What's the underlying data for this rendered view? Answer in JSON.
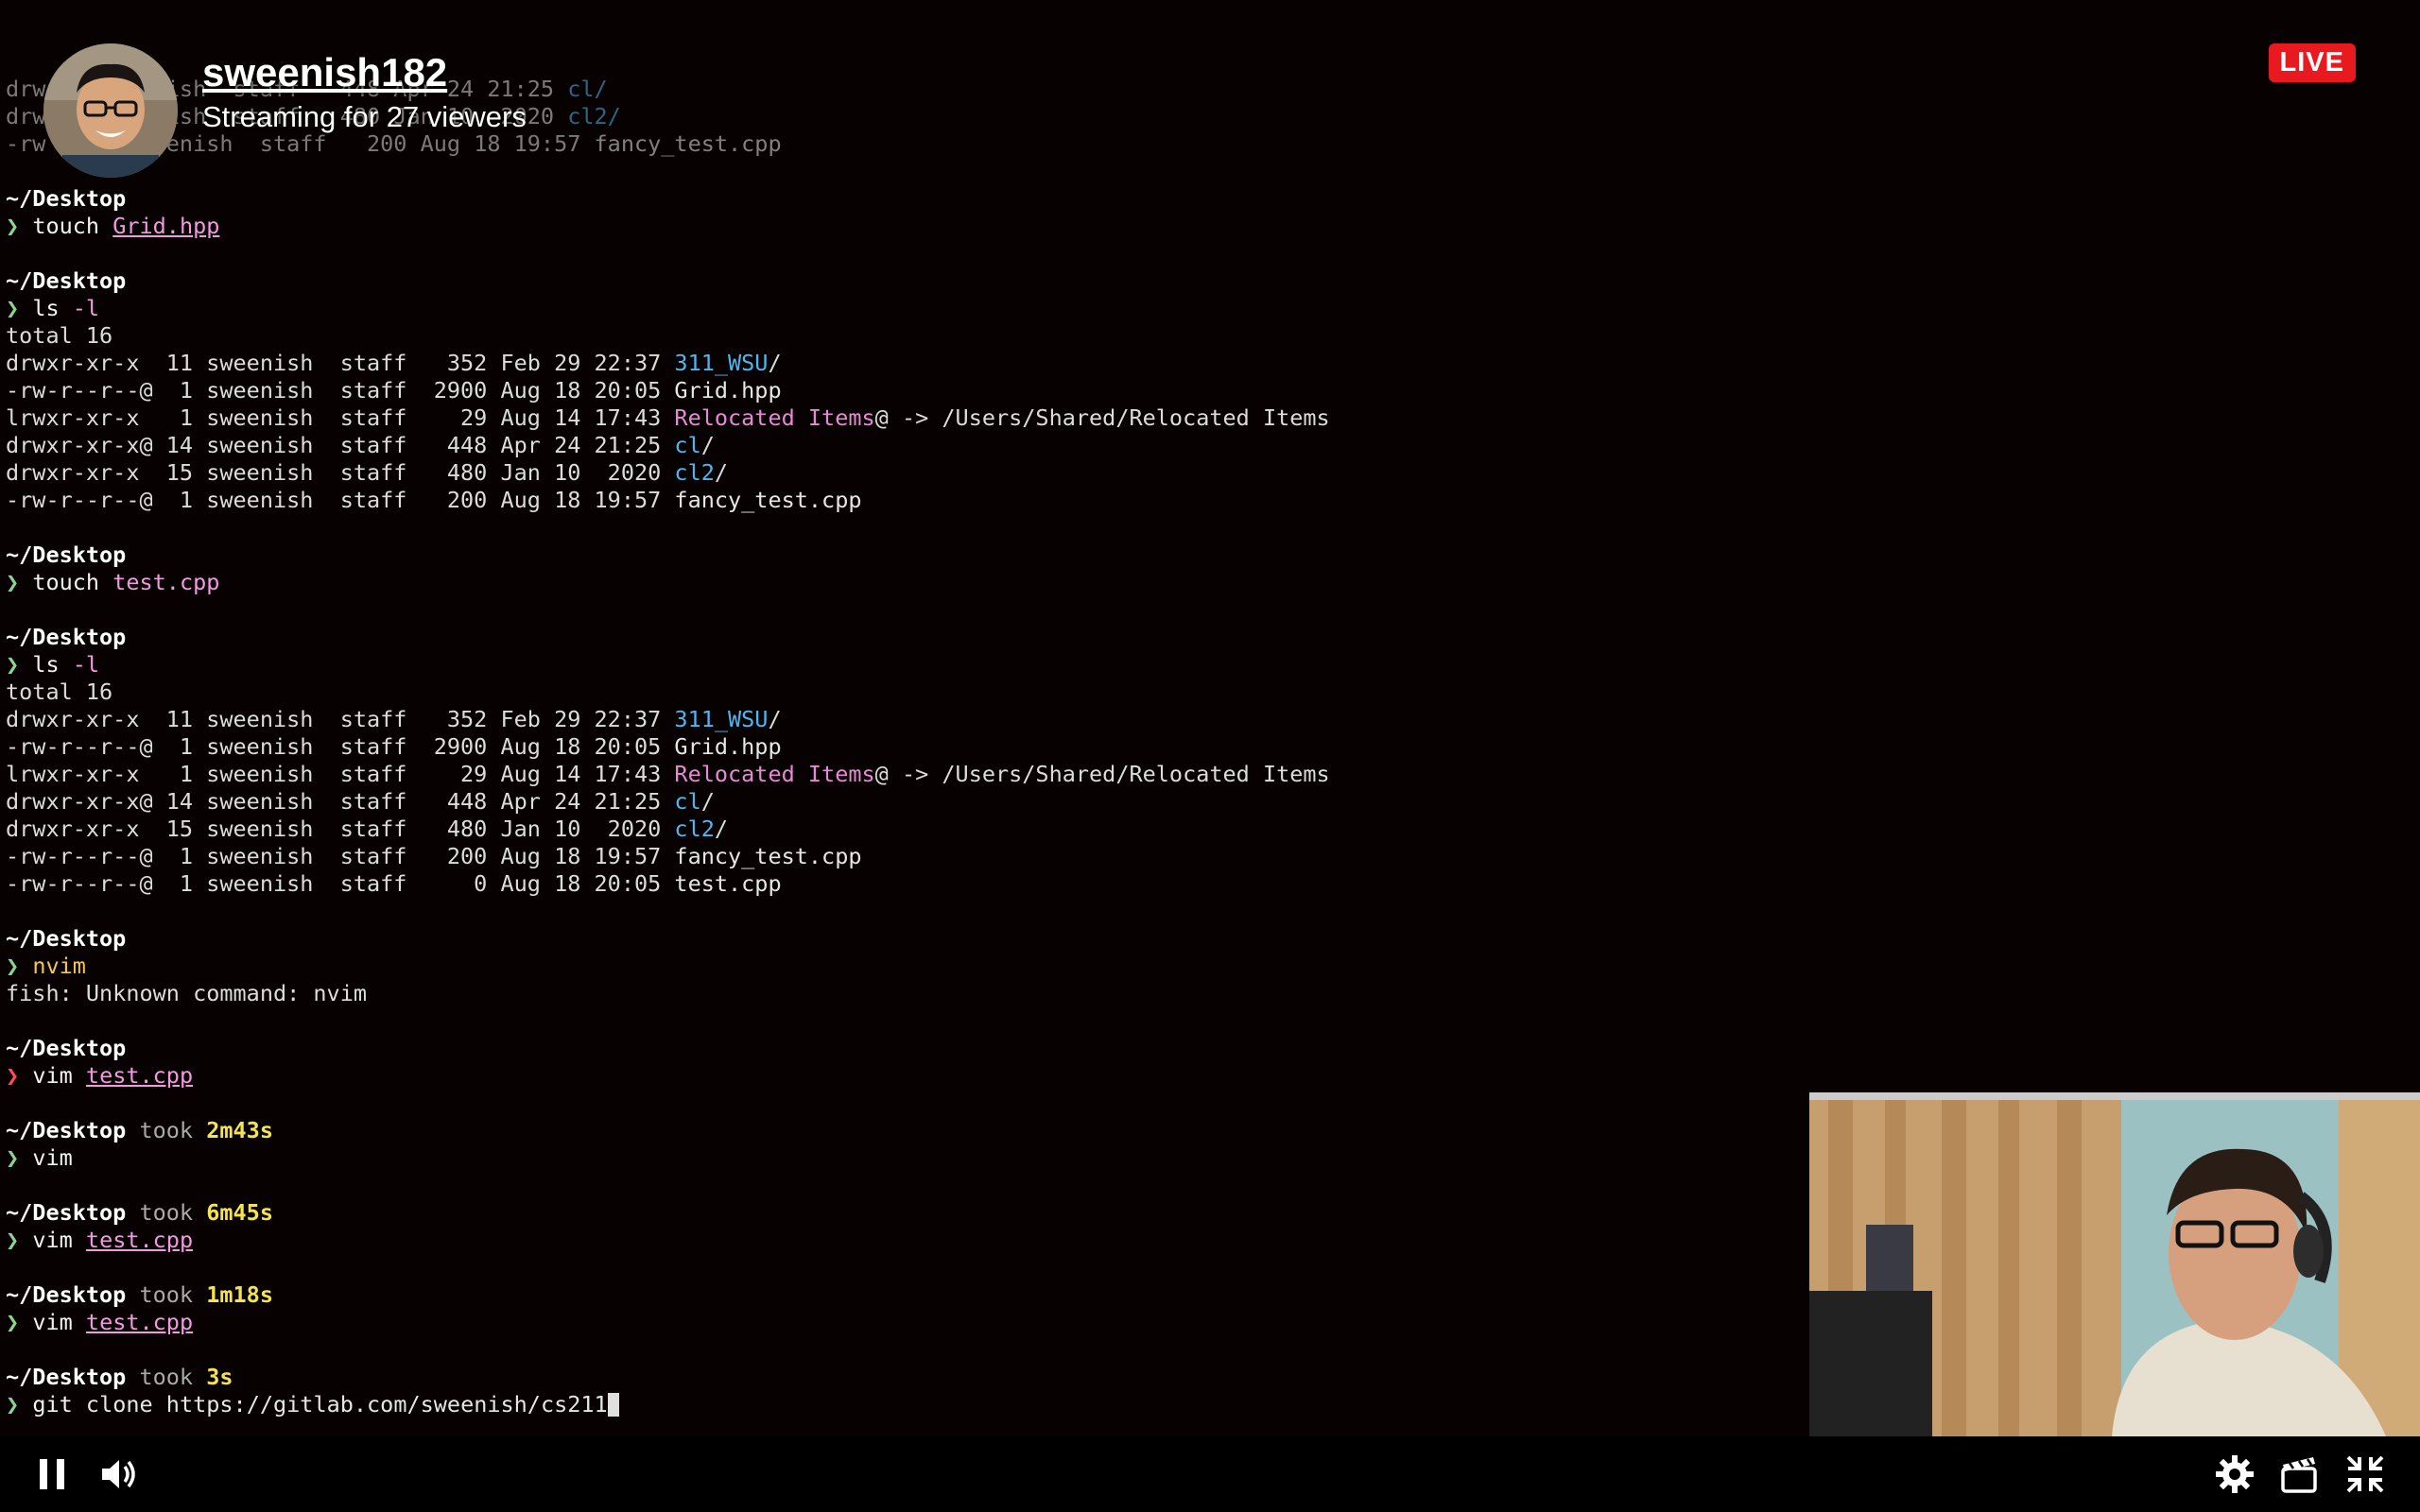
{
  "stream": {
    "username": "sweenish182",
    "viewers_text": "Streaming for 27 viewers",
    "live_label": "LIVE"
  },
  "terminal": {
    "top_partial": [
      {
        "perm": "drw",
        "rest": "4 sweenish  staff   448 Apr 24 21:25 ",
        "name": "cl/"
      },
      {
        "perm": "drw",
        "rest": "5 sweenish  staff   480 Jan 10  2020 ",
        "name": "cl2/"
      },
      {
        "perm": "-rw",
        "rest": "  1 sweenish  staff   200 Aug 18 19:57 ",
        "name": "fancy_test.cpp"
      }
    ],
    "blocks": [
      {
        "cwd": "~/Desktop",
        "arrow": "❯",
        "cmd": "touch",
        "arg": "Grid.hpp",
        "arg_style": "u",
        "output": []
      },
      {
        "cwd": "~/Desktop",
        "arrow": "❯",
        "cmd": "ls",
        "arg": "-l",
        "arg_style": "flag",
        "output": [
          {
            "t": "total 16"
          },
          {
            "p": "drwxr-xr-x  11 sweenish  staff   352 Feb 29 22:37 ",
            "n": "311_WSU",
            "c": "blue",
            "s": "/"
          },
          {
            "p": "-rw-r--r--@  1 sweenish  staff  2900 Aug 18 20:05 ",
            "n": "Grid.hpp",
            "c": "white",
            "s": ""
          },
          {
            "p": "lrwxr-xr-x   1 sweenish  staff    29 Aug 14 17:43 ",
            "n": "Relocated Items",
            "c": "pink",
            "s": "@ -> /Users/Shared/Relocated Items"
          },
          {
            "p": "drwxr-xr-x@ 14 sweenish  staff   448 Apr 24 21:25 ",
            "n": "cl",
            "c": "blue",
            "s": "/"
          },
          {
            "p": "drwxr-xr-x  15 sweenish  staff   480 Jan 10  2020 ",
            "n": "cl2",
            "c": "blue",
            "s": "/"
          },
          {
            "p": "-rw-r--r--@  1 sweenish  staff   200 Aug 18 19:57 ",
            "n": "fancy_test.cpp",
            "c": "white",
            "s": ""
          }
        ]
      },
      {
        "cwd": "~/Desktop",
        "arrow": "❯",
        "cmd": "touch",
        "arg": "test.cpp",
        "arg_style": "plain",
        "output": []
      },
      {
        "cwd": "~/Desktop",
        "arrow": "❯",
        "cmd": "ls",
        "arg": "-l",
        "arg_style": "flag",
        "output": [
          {
            "t": "total 16"
          },
          {
            "p": "drwxr-xr-x  11 sweenish  staff   352 Feb 29 22:37 ",
            "n": "311_WSU",
            "c": "blue",
            "s": "/"
          },
          {
            "p": "-rw-r--r--@  1 sweenish  staff  2900 Aug 18 20:05 ",
            "n": "Grid.hpp",
            "c": "white",
            "s": ""
          },
          {
            "p": "lrwxr-xr-x   1 sweenish  staff    29 Aug 14 17:43 ",
            "n": "Relocated Items",
            "c": "pink",
            "s": "@ -> /Users/Shared/Relocated Items"
          },
          {
            "p": "drwxr-xr-x@ 14 sweenish  staff   448 Apr 24 21:25 ",
            "n": "cl",
            "c": "blue",
            "s": "/"
          },
          {
            "p": "drwxr-xr-x  15 sweenish  staff   480 Jan 10  2020 ",
            "n": "cl2",
            "c": "blue",
            "s": "/"
          },
          {
            "p": "-rw-r--r--@  1 sweenish  staff   200 Aug 18 19:57 ",
            "n": "fancy_test.cpp",
            "c": "white",
            "s": ""
          },
          {
            "p": "-rw-r--r--@  1 sweenish  staff     0 Aug 18 20:05 ",
            "n": "test.cpp",
            "c": "white",
            "s": ""
          }
        ]
      },
      {
        "cwd": "~/Desktop",
        "arrow": "❯",
        "cmd": "nvim",
        "arg": "",
        "arg_style": "plain",
        "cmd_style": "warn",
        "output": [
          {
            "t": "fish: Unknown command: nvim"
          }
        ]
      },
      {
        "cwd": "~/Desktop",
        "arrow": "❯",
        "arrow_style": "red",
        "cmd": "vim",
        "arg": "test.cpp",
        "arg_style": "u",
        "output": []
      },
      {
        "cwd": "~/Desktop",
        "took": "took",
        "duration": "2m43s",
        "arrow": "❯",
        "cmd": "vim",
        "arg": "",
        "arg_style": "plain",
        "output": []
      },
      {
        "cwd": "~/Desktop",
        "took": "took",
        "duration": "6m45s",
        "arrow": "❯",
        "cmd": "vim",
        "arg": "test.cpp",
        "arg_style": "u",
        "output": []
      },
      {
        "cwd": "~/Desktop",
        "took": "took",
        "duration": "1m18s",
        "arrow": "❯",
        "cmd": "vim",
        "arg": "test.cpp",
        "arg_style": "u",
        "output": []
      },
      {
        "cwd": "~/Desktop",
        "took": "took",
        "duration": "3s",
        "arrow": "❯",
        "cmd": "git",
        "arg": "clone https://gitlab.com/sweenish/cs211",
        "arg_style": "gitarg",
        "cursor": true,
        "output": []
      }
    ]
  },
  "controls": {
    "left": [
      "pause-icon",
      "volume-icon"
    ],
    "right": [
      "gear-icon",
      "clapperboard-icon",
      "exit-fullscreen-icon"
    ]
  },
  "colors": {
    "background": "#070101",
    "live_red": "#e8191f",
    "dir_blue": "#4fb6f0",
    "symlink_pink": "#e68ad6",
    "duration_yellow": "#f4e44f"
  }
}
